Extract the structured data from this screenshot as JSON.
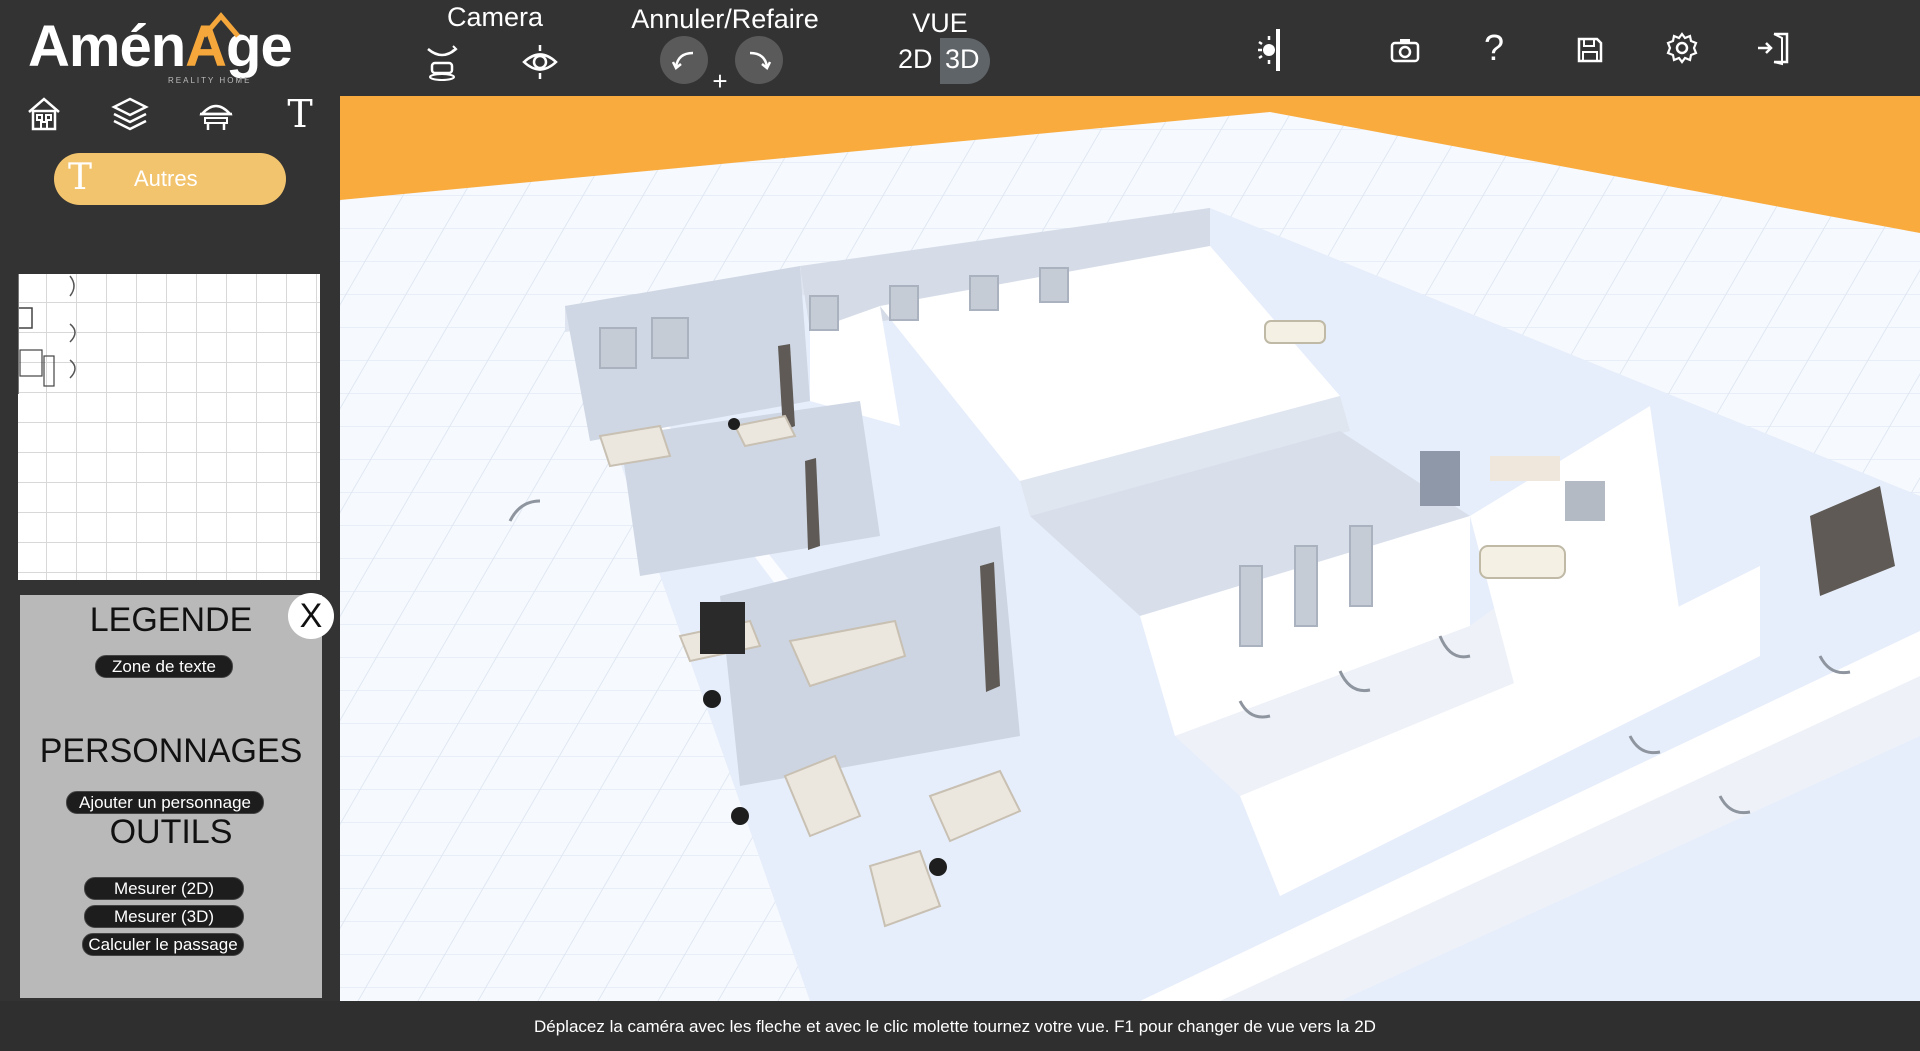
{
  "app": {
    "logo_text_start": "Amén",
    "logo_text_accent": "A",
    "logo_text_end": "ge",
    "logo_subtitle": "REALITY HOME"
  },
  "toolbar": {
    "camera_title": "Camera",
    "undo_redo_title": "Annuler/Refaire",
    "plus_label": "+",
    "view_title": "VUE",
    "view_2d_label": "2D",
    "view_3d_label": "3D",
    "help_label": "?",
    "active_view": "3D"
  },
  "left_tools": {
    "text_tool_label": "T",
    "selected_category": "Autres"
  },
  "legend_panel": {
    "close_label": "X",
    "legend_title": "LEGENDE",
    "text_zone_button": "Zone de texte",
    "characters_title": "PERSONNAGES",
    "add_character_button": "Ajouter un personnage",
    "tools_title": "OUTILS",
    "measure_2d_button": "Mesurer (2D)",
    "measure_3d_button": "Mesurer (3D)",
    "passage_button": "Calculer le passage"
  },
  "status": {
    "hint": "Déplacez la caméra avec les fleche et avec le clic molette tournez votre vue. F1 pour changer de vue vers la 2D"
  },
  "colors": {
    "accent": "#f5a73b",
    "accent_light": "#f3c46e",
    "bar_background": "#333333",
    "legend_background": "#b9b9b9"
  }
}
